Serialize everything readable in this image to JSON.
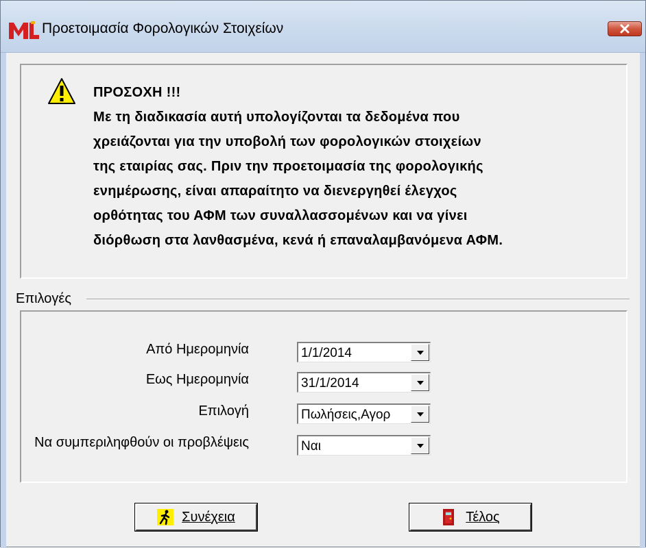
{
  "window": {
    "title": "Προετοιμασία Φορολογικών Στοιχείων",
    "close_label": "×"
  },
  "warning": {
    "heading": "ΠΡΟΣΟΧΗ !!!",
    "lines": [
      "Με τη διαδικασία αυτή υπολογίζονται τα δεδομένα που",
      "χρειάζονται για την υποβολή των φορολογικών στοιχείων",
      "της εταιρίας σας. Πριν την προετοιμασία της φορολογικής",
      "ενημέρωσης, είναι απαραίτητο να διενεργηθεί έλεγχος",
      "ορθότητας του ΑΦΜ των συναλλασσομένων και να γίνει",
      "διόρθωση στα λανθασμένα, κενά ή επαναλαμβανόμενα ΑΦΜ."
    ]
  },
  "options": {
    "caption": "Επιλογές",
    "fields": [
      {
        "label": "Από Ημερομηνία",
        "value": "1/1/2014"
      },
      {
        "label": "Εως Ημερομηνία",
        "value": "31/1/2014"
      },
      {
        "label": "Επιλογή",
        "value": "Πωλήσεις,Αγορ"
      },
      {
        "label": "Να συμπεριληφθούν οι προβλέψεις",
        "value": "Ναι"
      }
    ]
  },
  "buttons": {
    "continue_label": "Συνέχεια",
    "end_label": "Τέλος"
  },
  "colors": {
    "titlebar": "#c8d8ec",
    "close_button": "#c1391f",
    "warning_yellow": "#ffee00",
    "face": "#f0f0f0"
  },
  "icons": {
    "app": "app-logo-icon",
    "warning": "warning-triangle-icon",
    "continue": "running-man-icon",
    "end": "door-exit-icon",
    "dropdown": "chevron-down-icon"
  }
}
